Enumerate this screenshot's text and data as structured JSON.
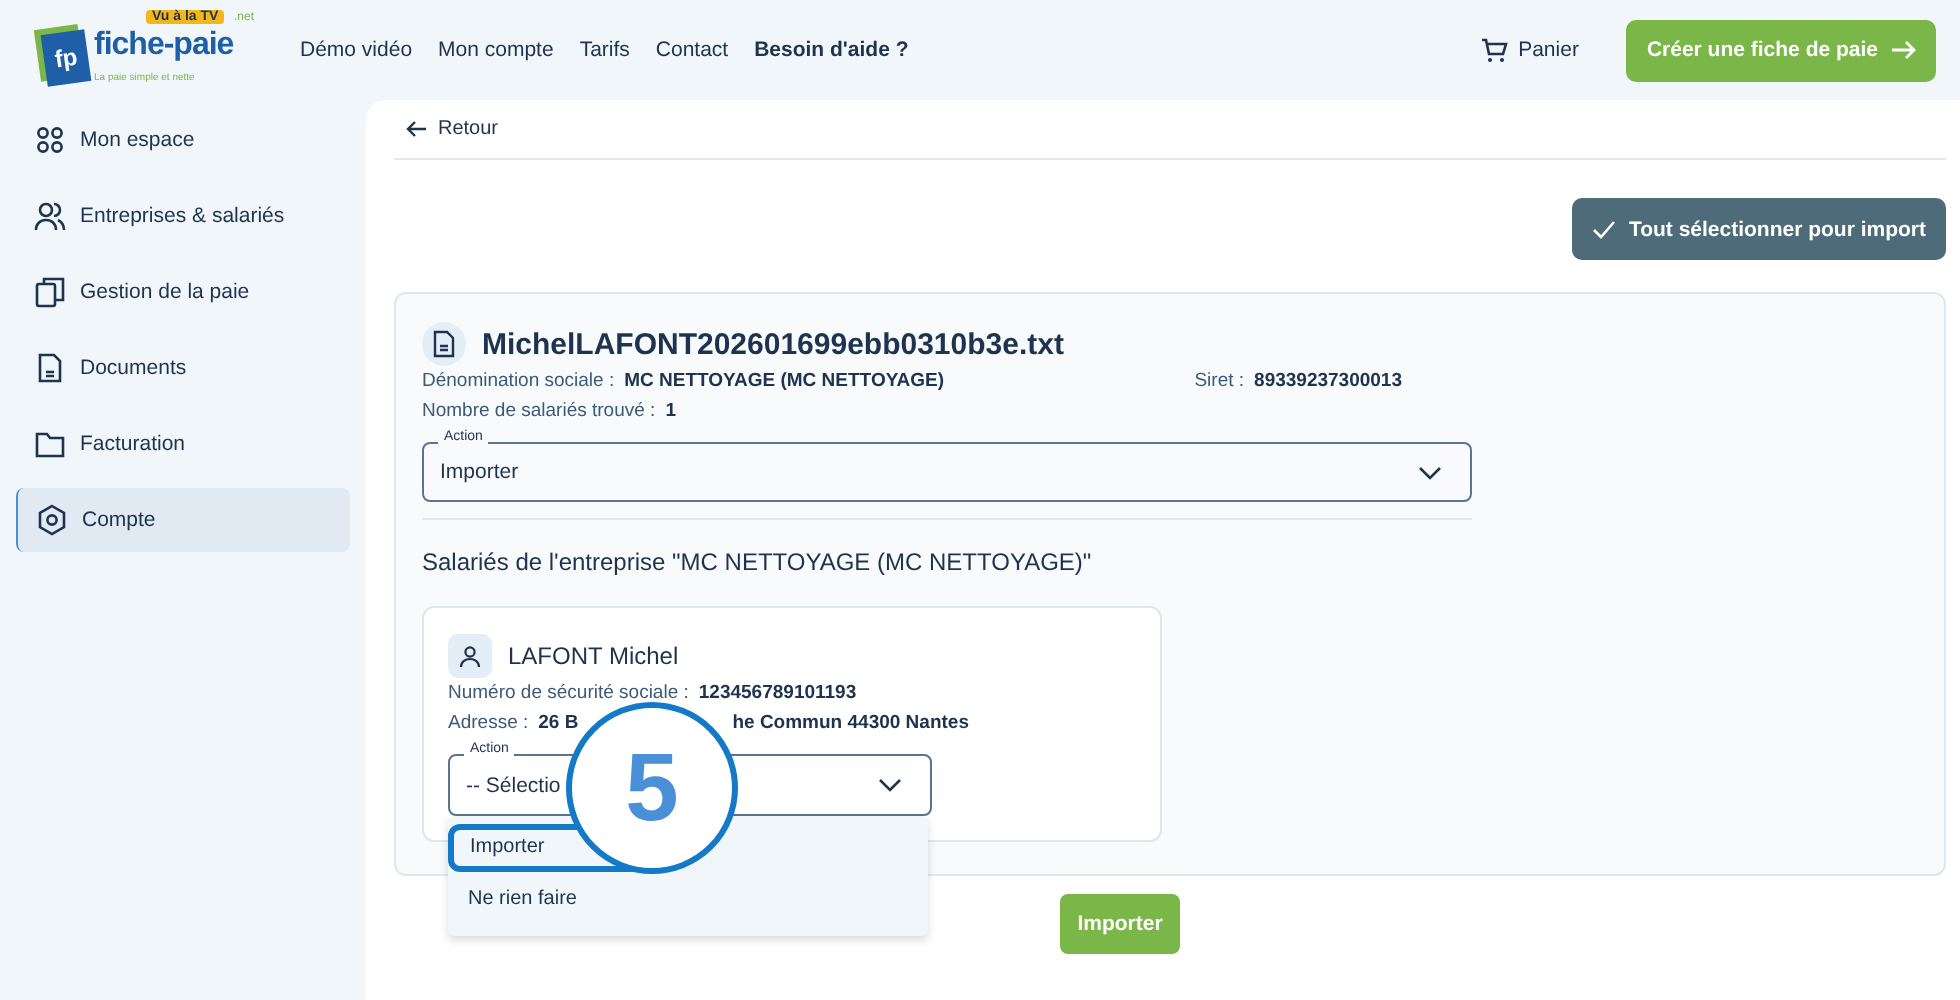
{
  "logo": {
    "badge": "Vu à la TV",
    "name": "fiche-paie",
    "suffix": ".net",
    "mark": "fp",
    "tagline": "La paie simple et nette"
  },
  "nav": [
    "Démo vidéo",
    "Mon compte",
    "Tarifs",
    "Contact",
    "Besoin d'aide ?"
  ],
  "cart": "Panier",
  "cta": "Créer une fiche de paie",
  "sidebar": {
    "items": [
      {
        "label": "Mon espace",
        "selected": false
      },
      {
        "label": "Entreprises & salariés",
        "selected": false
      },
      {
        "label": "Gestion de la paie",
        "selected": false
      },
      {
        "label": "Documents",
        "selected": false
      },
      {
        "label": "Facturation",
        "selected": false
      },
      {
        "label": "Compte",
        "selected": true
      }
    ]
  },
  "back": "Retour",
  "select_all": "Tout sélectionner pour import",
  "file": {
    "name": "MichelLAFONT202601699ebb0310b3e.txt",
    "company_label": "Dénomination sociale :",
    "company": "MC NETTOYAGE (MC NETTOYAGE)",
    "siret_label": "Siret :",
    "siret": "89339237300013",
    "count_label": "Nombre de salariés trouvé :",
    "count": "1",
    "action_label": "Action",
    "action": "Importer"
  },
  "employees_title": "Salariés de l'entreprise \"MC NETTOYAGE (MC NETTOYAGE)\"",
  "employee": {
    "name": "LAFONT Michel",
    "ss_label": "Numéro de sécurité sociale :",
    "ss": "123456789101193",
    "address_label": "Adresse :",
    "address_parts": [
      "26 B",
      "he Commun 44300 Nantes"
    ],
    "action_label": "Action",
    "action": "-- Sélectio",
    "options": [
      {
        "label": "Importer",
        "selected": true
      },
      {
        "label": "Ne rien faire",
        "selected": false
      }
    ]
  },
  "import_button": "Importer",
  "callout": "5"
}
